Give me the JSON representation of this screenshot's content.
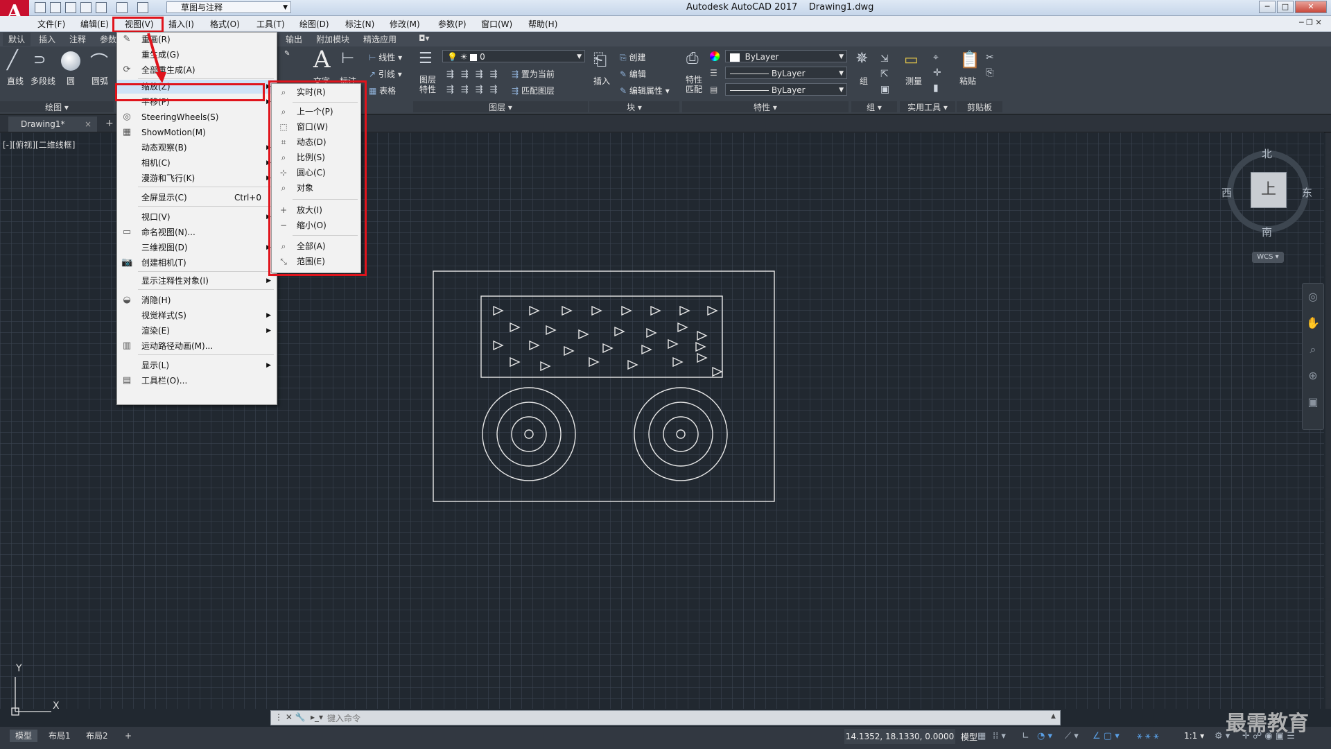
{
  "app": {
    "title": "Autodesk AutoCAD 2017",
    "file": "Drawing1.dwg",
    "logo_letter": "A",
    "workspace": "草图与注释"
  },
  "menubar": [
    "文件(F)",
    "编辑(E)",
    "视图(V)",
    "插入(I)",
    "格式(O)",
    "工具(T)",
    "绘图(D)",
    "标注(N)",
    "修改(M)",
    "参数(P)",
    "窗口(W)",
    "帮助(H)"
  ],
  "ribbon_tabs": [
    "默认",
    "插入",
    "注释",
    "参数",
    "输出",
    "附加模块",
    "精选应用"
  ],
  "ribbon": {
    "draw": {
      "line": "直线",
      "polyline": "多段线",
      "circle": "圆",
      "arc": "圆弧",
      "panel": "绘图"
    },
    "annotation": {
      "text": "文字",
      "dim": "标注",
      "linear": "线性",
      "leader": "引线",
      "table": "表格"
    },
    "layers": {
      "props": "图层特性",
      "current_layer": "0",
      "set_current": "置为当前",
      "match": "匹配图层",
      "panel": "图层"
    },
    "block": {
      "insert": "插入",
      "create": "创建",
      "edit": "编辑",
      "edit_attr": "编辑属性",
      "panel": "块"
    },
    "properties": {
      "match": "特性匹配",
      "color": "ByLayer",
      "linetype": "ByLayer",
      "lineweight": "ByLayer",
      "panel": "特性"
    },
    "groups": {
      "group": "组",
      "panel": "组"
    },
    "utilities": {
      "measure": "测量",
      "panel": "实用工具"
    },
    "clipboard": {
      "paste": "粘贴",
      "panel": "剪贴板"
    }
  },
  "filetab": {
    "name": "Drawing1*",
    "close": "×",
    "add": "+"
  },
  "viewport_label": "[-][俯视][二维线框]",
  "view_menu": {
    "items": [
      {
        "label": "重画(R)",
        "icon": "pencil-icon"
      },
      {
        "label": "重生成(G)",
        "icon": ""
      },
      {
        "label": "全部重生成(A)",
        "icon": "regen-all-icon"
      },
      {
        "label": "缩放(Z)",
        "icon": "",
        "arrow": true
      },
      {
        "label": "平移(P)",
        "icon": "",
        "arrow": true
      },
      {
        "label": "SteeringWheels(S)",
        "icon": "wheel-icon"
      },
      {
        "label": "ShowMotion(M)",
        "icon": "showmotion-icon"
      },
      {
        "label": "动态观察(B)",
        "icon": "",
        "arrow": true
      },
      {
        "label": "相机(C)",
        "icon": "",
        "arrow": true
      },
      {
        "label": "漫游和飞行(K)",
        "icon": "",
        "arrow": true
      },
      {
        "label": "全屏显示(C)",
        "icon": "",
        "shortcut": "Ctrl+0"
      },
      {
        "label": "视口(V)",
        "icon": "",
        "arrow": true
      },
      {
        "label": "命名视图(N)...",
        "icon": "named-view-icon"
      },
      {
        "label": "三维视图(D)",
        "icon": "",
        "arrow": true
      },
      {
        "label": "创建相机(T)",
        "icon": "camera-icon"
      },
      {
        "label": "显示注释性对象(I)",
        "icon": "",
        "arrow": true
      },
      {
        "label": "消隐(H)",
        "icon": "hide-icon"
      },
      {
        "label": "视觉样式(S)",
        "icon": "",
        "arrow": true
      },
      {
        "label": "渲染(E)",
        "icon": "",
        "arrow": true
      },
      {
        "label": "运动路径动画(M)...",
        "icon": "motion-path-icon"
      },
      {
        "label": "显示(L)",
        "icon": "",
        "arrow": true
      },
      {
        "label": "工具栏(O)...",
        "icon": "toolbar-icon"
      }
    ]
  },
  "zoom_submenu": {
    "items": [
      "实时(R)",
      "上一个(P)",
      "窗口(W)",
      "动态(D)",
      "比例(S)",
      "圆心(C)",
      "对象",
      "放大(I)",
      "缩小(O)",
      "全部(A)",
      "范围(E)"
    ]
  },
  "viewcube": {
    "north": "北",
    "south": "南",
    "west": "西",
    "east": "东",
    "top": "上",
    "wcs": "WCS"
  },
  "ucs": {
    "y": "Y",
    "x": "X"
  },
  "command_line": {
    "placeholder": "键入命令"
  },
  "layout_tabs": [
    "模型",
    "布局1",
    "布局2"
  ],
  "status": {
    "coords": "14.1352, 18.1330, 0.0000",
    "model": "模型",
    "scale": "1:1"
  },
  "watermark": "最需教育",
  "colors": {
    "highlight_box": "#e0141c",
    "canvas_bg": "#212830"
  }
}
